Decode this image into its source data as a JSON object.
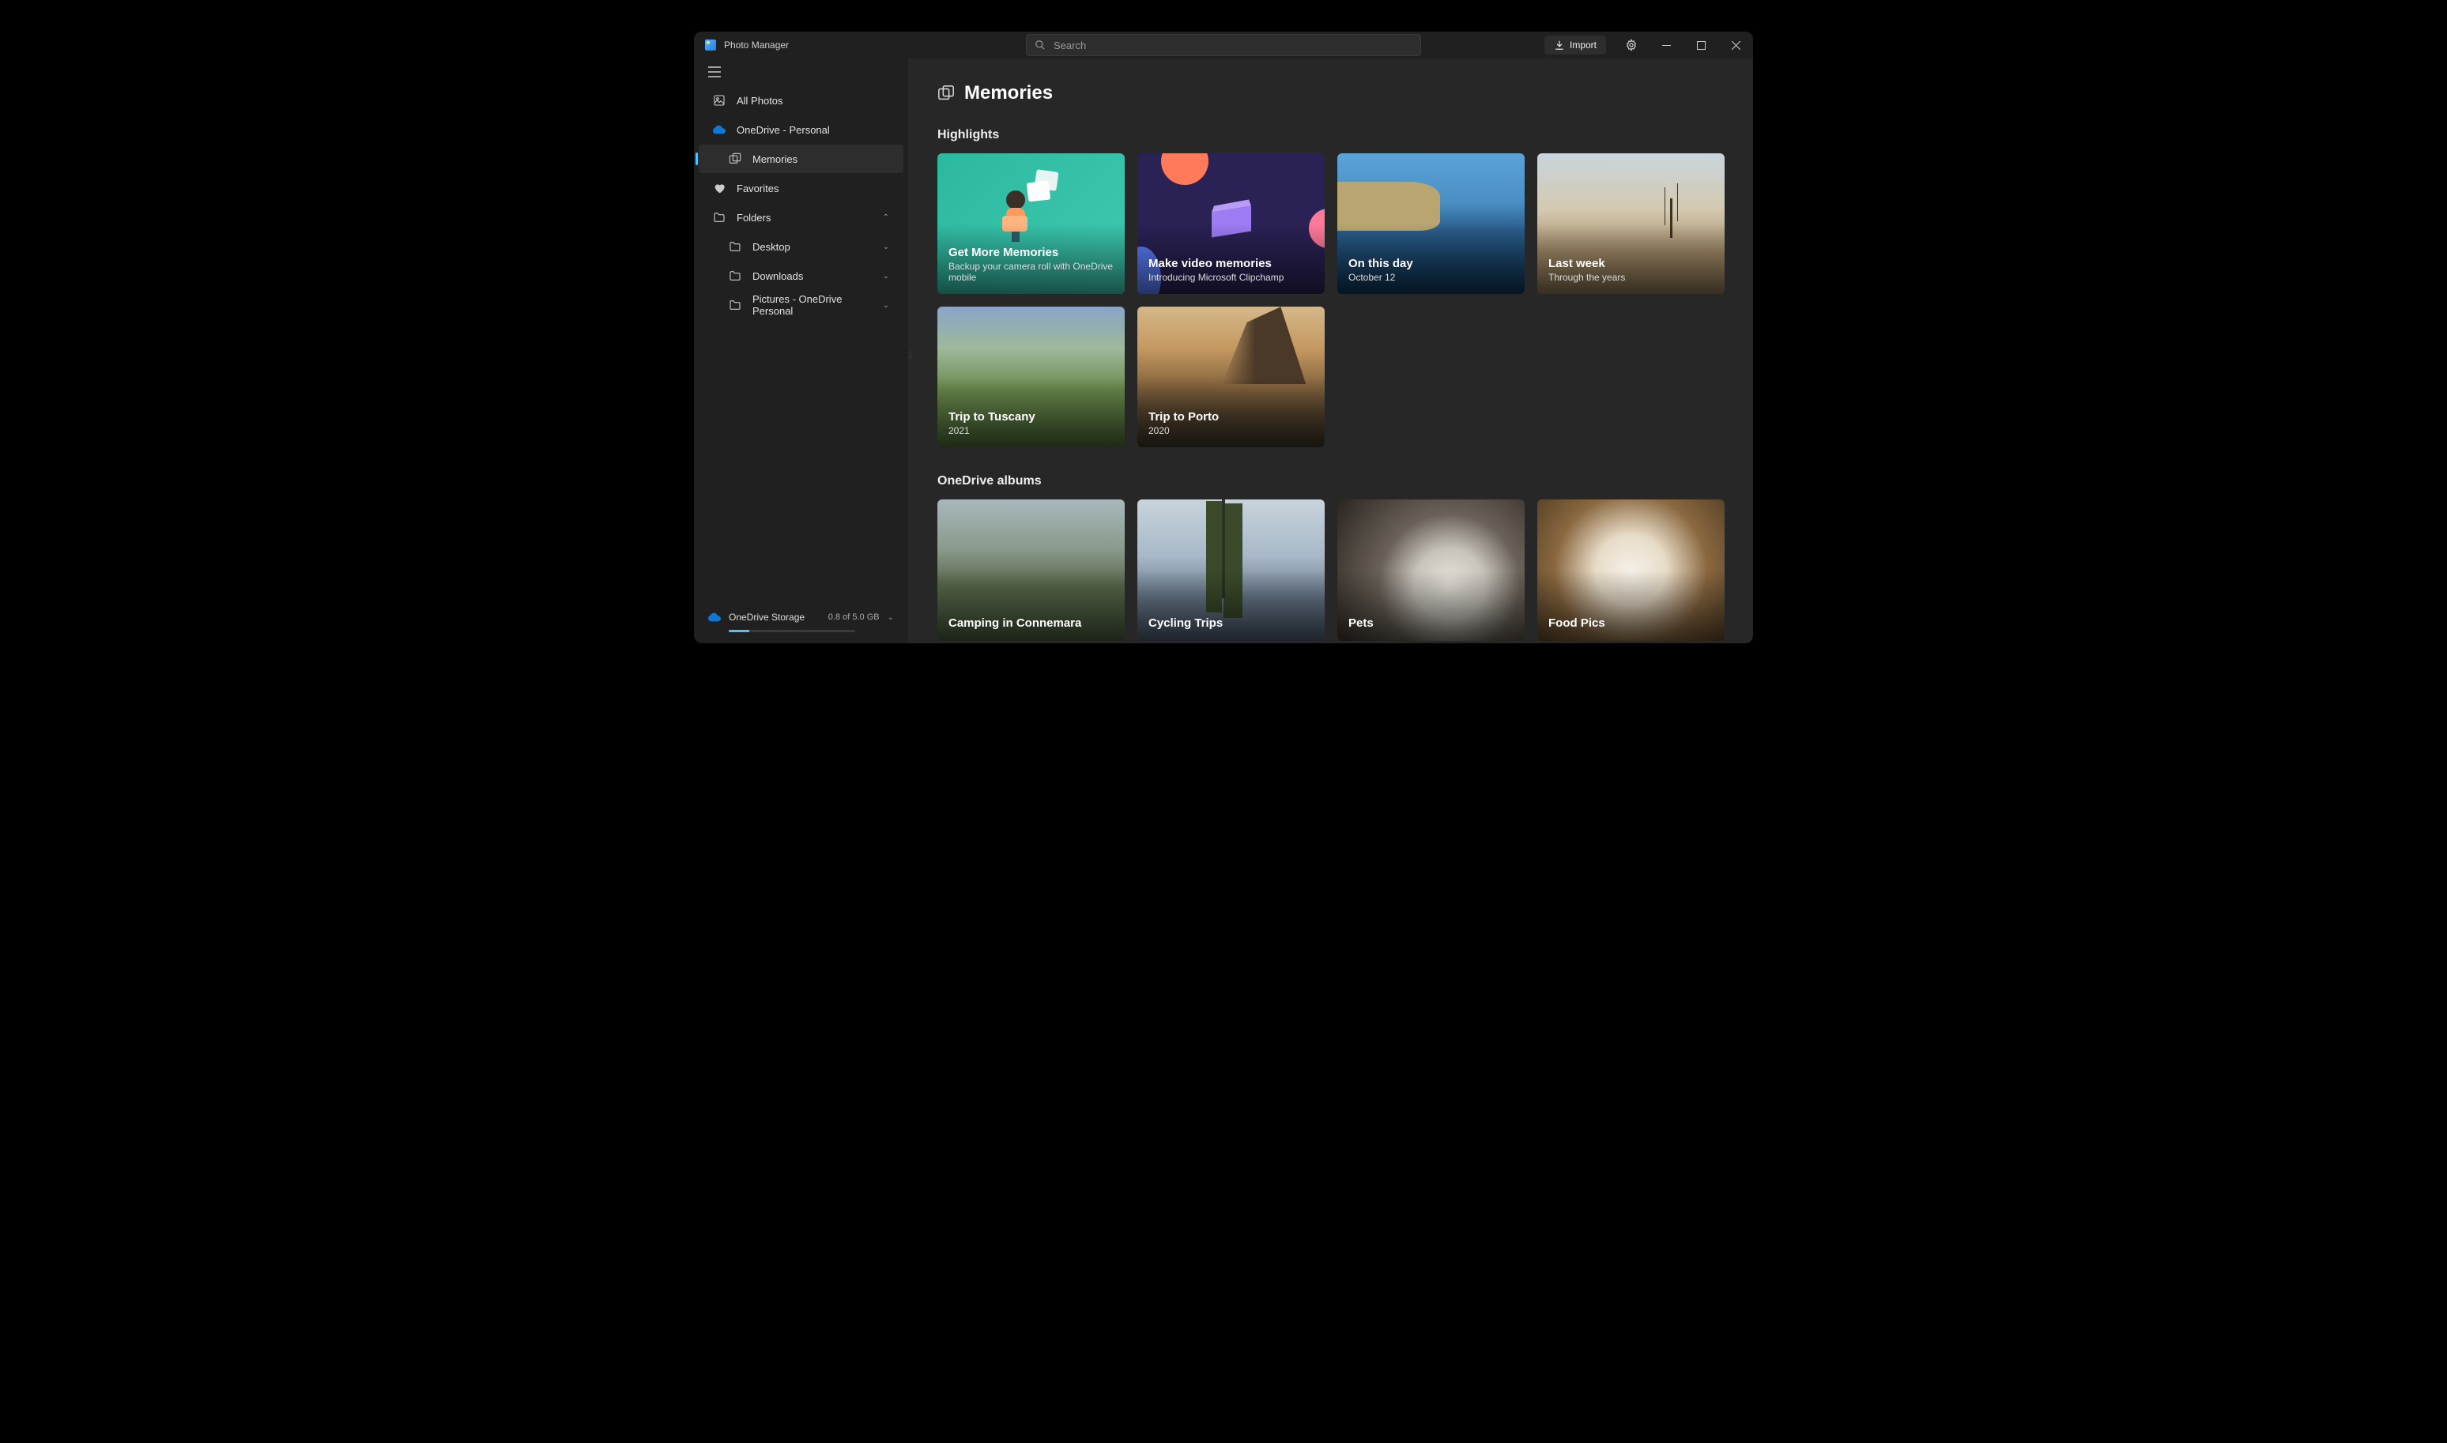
{
  "app": {
    "name": "Photo Manager"
  },
  "search": {
    "placeholder": "Search"
  },
  "toolbar": {
    "import_label": "Import"
  },
  "sidebar": {
    "all_photos": "All Photos",
    "onedrive": "OneDrive - Personal",
    "memories": "Memories",
    "favorites": "Favorites",
    "folders": "Folders",
    "folder_items": {
      "desktop": "Desktop",
      "downloads": "Downloads",
      "pictures": "Pictures - OneDrive Personal"
    },
    "storage": {
      "label": "OneDrive Storage",
      "usage": "0.8 of 5.0 GB"
    }
  },
  "main": {
    "title": "Memories",
    "highlights_label": "Highlights",
    "albums_label": "OneDrive albums",
    "highlights": [
      {
        "title": "Get More Memories",
        "sub": "Backup your camera roll with OneDrive mobile"
      },
      {
        "title": "Make video memories",
        "sub": "Introducing Microsoft Clipchamp"
      },
      {
        "title": "On this day",
        "sub": "October 12"
      },
      {
        "title": "Last week",
        "sub": "Through the years"
      },
      {
        "title": "Trip to Tuscany",
        "sub": "2021"
      },
      {
        "title": "Trip to Porto",
        "sub": "2020"
      }
    ],
    "albums": [
      {
        "title": "Camping in Connemara"
      },
      {
        "title": "Cycling Trips"
      },
      {
        "title": "Pets"
      },
      {
        "title": "Food Pics"
      }
    ]
  }
}
